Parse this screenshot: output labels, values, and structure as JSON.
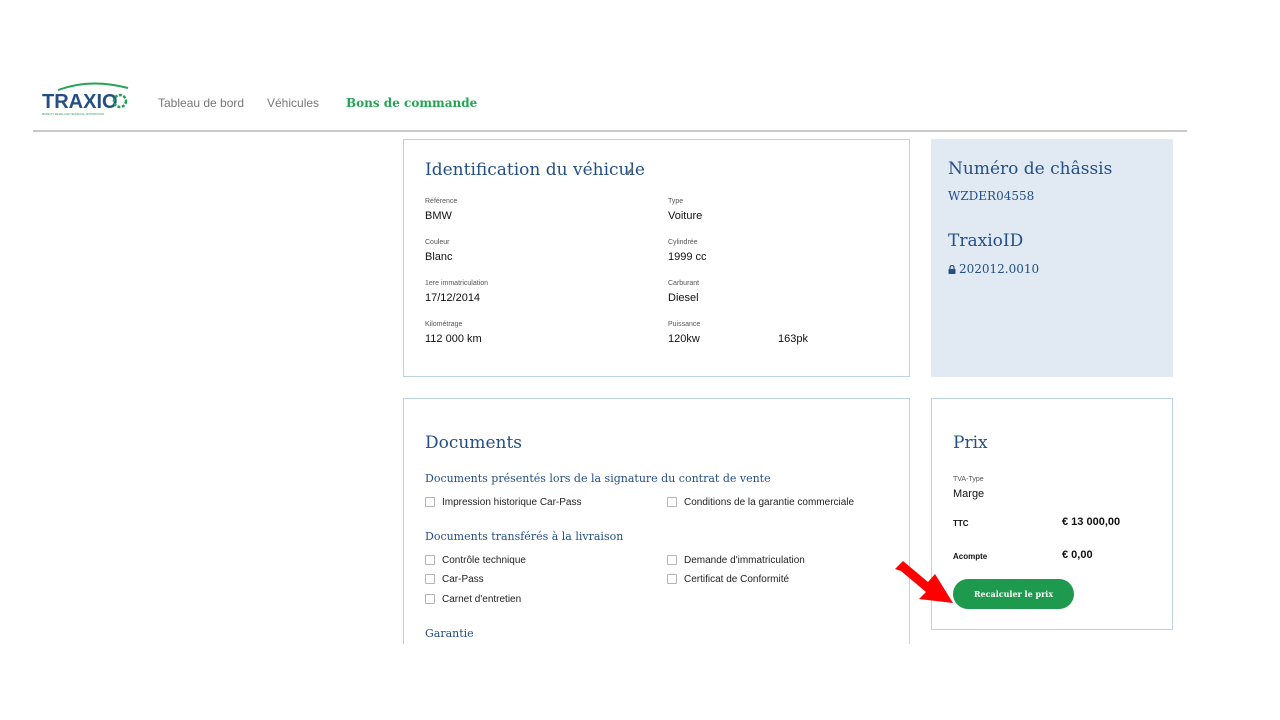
{
  "header": {
    "logo_text": "TRAXIO",
    "logo_tagline": "MOBILITY RETAIL AND TECHNICAL DISTRIBUTION",
    "nav": [
      {
        "label": "Tableau de bord",
        "active": false
      },
      {
        "label": "Véhicules",
        "active": false
      },
      {
        "label": "Bons de commande",
        "active": true
      }
    ]
  },
  "vehicle": {
    "title": "Identification du véhicule",
    "edit_icon": "pencil-icon",
    "fields": {
      "reference": {
        "label": "Référence",
        "value": "BMW"
      },
      "type": {
        "label": "Type",
        "value": "Voiture"
      },
      "couleur": {
        "label": "Couleur",
        "value": "Blanc"
      },
      "cylindree": {
        "label": "Cylindrée",
        "value": "1999 cc"
      },
      "immatriculation": {
        "label": "1ere immatriculation",
        "value": "17/12/2014"
      },
      "carburant": {
        "label": "Carburant",
        "value": "Diesel"
      },
      "kilometrage": {
        "label": "Kilométrage",
        "value": "112 000 km"
      },
      "puissance": {
        "label": "Puissance",
        "value_kw": "120kw",
        "value_pk": "163pk"
      }
    }
  },
  "chassis": {
    "title": "Numéro de châssis",
    "number": "WZDER04558",
    "traxio_title": "TraxioID",
    "traxio_id": "202012.0010",
    "lock_icon": "lock-icon"
  },
  "documents": {
    "title": "Documents",
    "section_signature": "Documents présentés lors de la signature du contrat de vente",
    "signature_items": [
      "Impression historique Car-Pass",
      "Conditions de la garantie commerciale"
    ],
    "section_livraison": "Documents transférés à la livraison",
    "livraison_items": [
      "Contrôle technique",
      "Demande d'immatriculation",
      "Car-Pass",
      "Certificat de Conformité",
      "Carnet d'entretien"
    ],
    "section_garantie": "Garantie"
  },
  "prix": {
    "title": "Prix",
    "tva_label": "TVA-Type",
    "tva_value": "Marge",
    "ttc_label": "TTC",
    "ttc_value": "€ 13 000,00",
    "acompte_label": "Acompte",
    "acompte_value": "€ 0,00",
    "button_label": "Recalculer le prix"
  },
  "colors": {
    "brand_green": "#23a455",
    "brand_blue": "#244f86",
    "button_green": "#1e9a4f",
    "panel_bg": "#e1e9f2",
    "arrow_red": "#ff0000"
  }
}
